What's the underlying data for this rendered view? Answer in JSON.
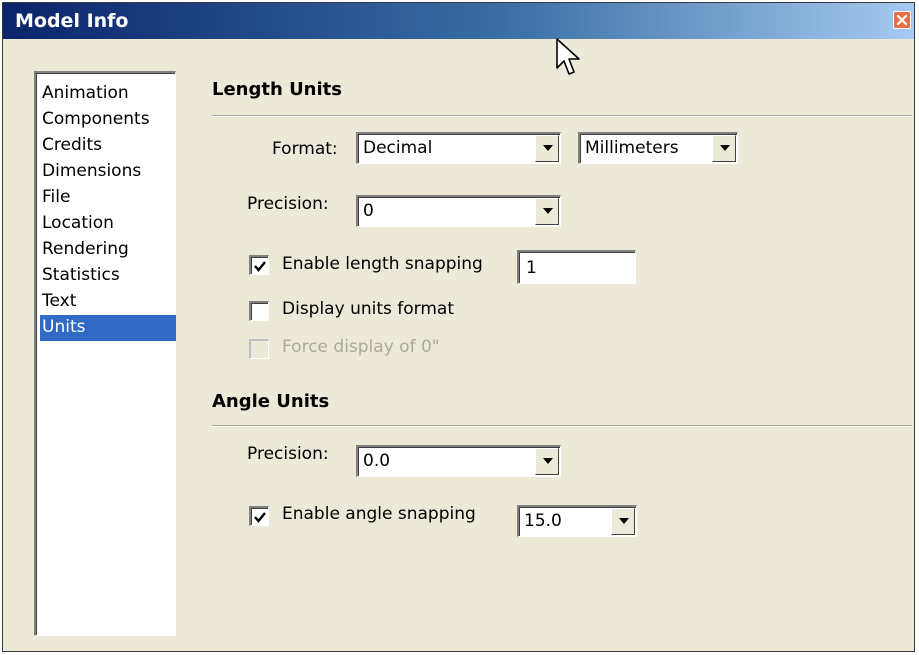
{
  "window": {
    "title": "Model Info"
  },
  "sidebar": {
    "items": [
      {
        "label": "Animation"
      },
      {
        "label": "Components"
      },
      {
        "label": "Credits"
      },
      {
        "label": "Dimensions"
      },
      {
        "label": "File"
      },
      {
        "label": "Location"
      },
      {
        "label": "Rendering"
      },
      {
        "label": "Statistics"
      },
      {
        "label": "Text"
      },
      {
        "label": "Units",
        "selected": true
      }
    ]
  },
  "length_units": {
    "heading": "Length Units",
    "format_label": "Format:",
    "format_value": "Decimal",
    "unit_value": "Millimeters",
    "precision_label": "Precision:",
    "precision_value": "0",
    "enable_snapping_label": "Enable length snapping",
    "enable_snapping_checked": true,
    "snapping_value": "1",
    "display_units_label": "Display units format",
    "display_units_checked": false,
    "force_display_label": "Force display of 0\"",
    "force_display_checked": false,
    "force_display_disabled": true
  },
  "angle_units": {
    "heading": "Angle Units",
    "precision_label": "Precision:",
    "precision_value": "0.0",
    "enable_snapping_label": "Enable angle snapping",
    "enable_snapping_checked": true,
    "snapping_value": "15.0"
  },
  "colors": {
    "dialog_bg": "#ece9d8",
    "title_bar_start": "#0a246a",
    "title_bar_end": "#a6caf0",
    "selection": "#316ac5",
    "disabled_text": "#aca899",
    "close_button": "#e6704a"
  }
}
